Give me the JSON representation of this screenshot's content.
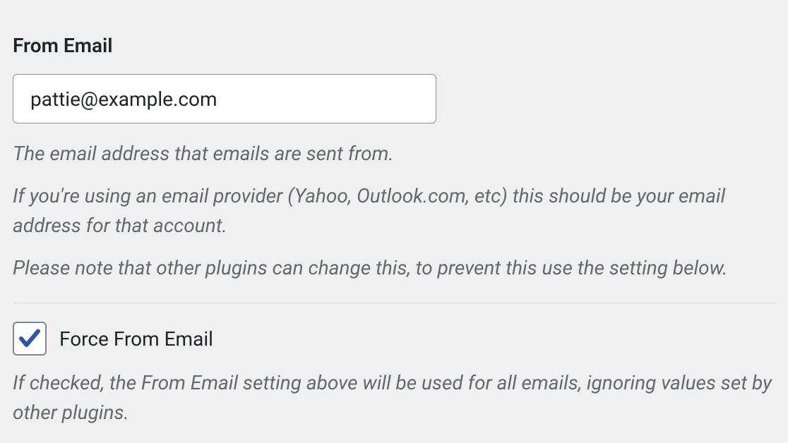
{
  "from_email": {
    "label": "From Email",
    "value": "pattie@example.com",
    "help_line_1": "The email address that emails are sent from.",
    "help_line_2": "If you're using an email provider (Yahoo, Outlook.com, etc) this should be your email address for that account.",
    "help_line_3": "Please note that other plugins can change this, to prevent this use the setting below."
  },
  "force_from_email": {
    "label": "Force From Email",
    "checked": true,
    "help": "If checked, the From Email setting above will be used for all emails, ignoring values set by other plugins."
  }
}
